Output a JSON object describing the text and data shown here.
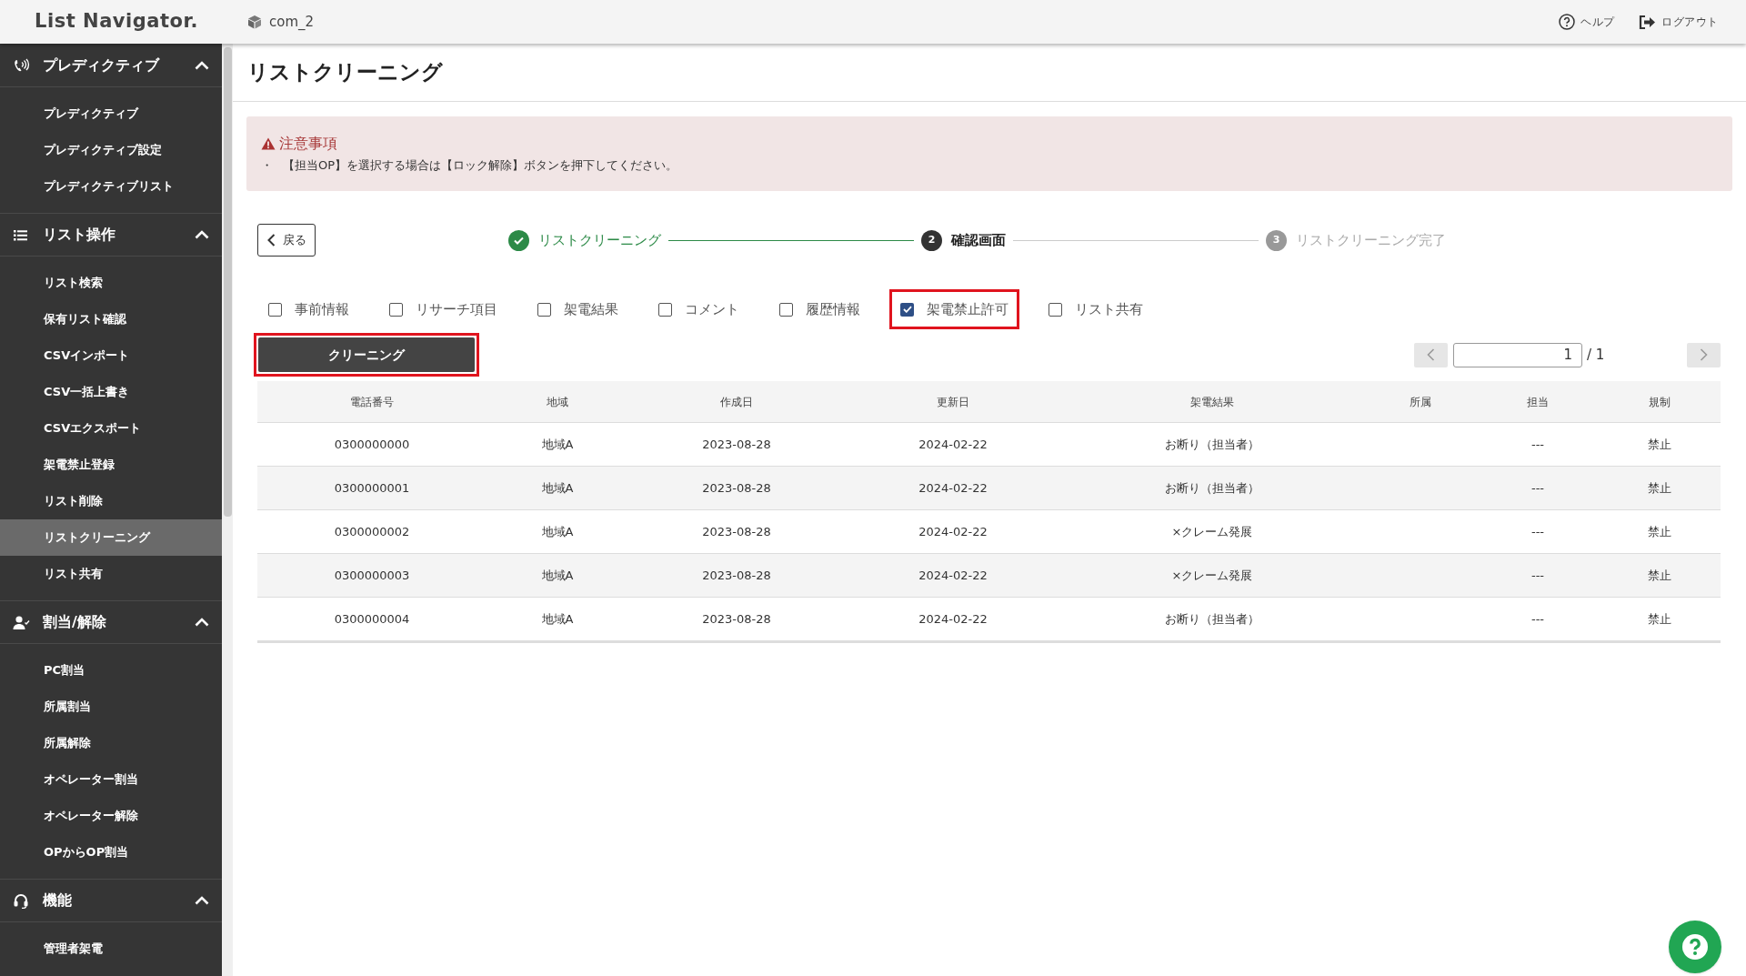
{
  "header": {
    "logo": "List Navigator.",
    "company": "com_2",
    "links": [
      {
        "kind": "help",
        "label": "ヘルプ"
      },
      {
        "kind": "logout",
        "label": "ログアウト"
      }
    ]
  },
  "sidebar": {
    "sections": [
      {
        "kind": "phone",
        "label": "プレディクティブ",
        "expanded": true,
        "items": [
          {
            "label": "プレディクティブ",
            "selected": false
          },
          {
            "label": "プレディクティブ設定",
            "selected": false
          },
          {
            "label": "プレディクティブリスト",
            "selected": false
          }
        ]
      },
      {
        "kind": "list",
        "label": "リスト操作",
        "expanded": true,
        "items": [
          {
            "label": "リスト検索",
            "selected": false
          },
          {
            "label": "保有リスト確認",
            "selected": false
          },
          {
            "label": "CSVインポート",
            "selected": false
          },
          {
            "label": "CSV一括上書き",
            "selected": false
          },
          {
            "label": "CSVエクスポート",
            "selected": false
          },
          {
            "label": "架電禁止登録",
            "selected": false
          },
          {
            "label": "リスト削除",
            "selected": false
          },
          {
            "label": "リストクリーニング",
            "selected": true
          },
          {
            "label": "リスト共有",
            "selected": false
          }
        ]
      },
      {
        "kind": "user",
        "label": "割当/解除",
        "expanded": true,
        "items": [
          {
            "label": "PC割当",
            "selected": false
          },
          {
            "label": "所属割当",
            "selected": false
          },
          {
            "label": "所属解除",
            "selected": false
          },
          {
            "label": "オペレーター割当",
            "selected": false
          },
          {
            "label": "オペレーター解除",
            "selected": false
          },
          {
            "label": "OPからOP割当",
            "selected": false
          }
        ]
      },
      {
        "kind": "headset",
        "label": "機能",
        "expanded": true,
        "items": [
          {
            "label": "管理者架電",
            "selected": false
          }
        ]
      }
    ]
  },
  "page": {
    "title": "リストクリーニング",
    "notice": {
      "title": "注意事項",
      "bullet": "・",
      "text": "【担当OP】を選択する場合は【ロック解除】ボタンを押下してください。"
    },
    "back_button": "戻る",
    "steps": [
      {
        "done": true,
        "current": false,
        "label": "リストクリーニング"
      },
      {
        "done": false,
        "current": true,
        "number": "2",
        "label": "確認画面"
      },
      {
        "done": false,
        "current": false,
        "number": "3",
        "label": "リストクリーニング完了"
      }
    ],
    "options": [
      {
        "label": "事前情報",
        "checked": false,
        "highlighted": false
      },
      {
        "label": "リサーチ項目",
        "checked": false,
        "highlighted": false
      },
      {
        "label": "架電結果",
        "checked": false,
        "highlighted": false
      },
      {
        "label": "コメント",
        "checked": false,
        "highlighted": false
      },
      {
        "label": "履歴情報",
        "checked": false,
        "highlighted": false
      },
      {
        "label": "架電禁止許可",
        "checked": true,
        "highlighted": true
      },
      {
        "label": "リスト共有",
        "checked": false,
        "highlighted": false
      }
    ],
    "clean_button": {
      "label": "クリーニング",
      "highlighted": true
    },
    "pager": {
      "value": "1",
      "total": "/ 1"
    },
    "table": {
      "columns": [
        "電話番号",
        "地域",
        "作成日",
        "更新日",
        "架電結果",
        "所属",
        "担当",
        "規制"
      ],
      "rows": [
        [
          "0300000000",
          "地域A",
          "2023-08-28",
          "2024-02-22",
          "お断り（担当者）",
          "",
          "---",
          "禁止"
        ],
        [
          "0300000001",
          "地域A",
          "2023-08-28",
          "2024-02-22",
          "お断り（担当者）",
          "",
          "---",
          "禁止"
        ],
        [
          "0300000002",
          "地域A",
          "2023-08-28",
          "2024-02-22",
          "×クレーム発展",
          "",
          "---",
          "禁止"
        ],
        [
          "0300000003",
          "地域A",
          "2023-08-28",
          "2024-02-22",
          "×クレーム発展",
          "",
          "---",
          "禁止"
        ],
        [
          "0300000004",
          "地域A",
          "2023-08-28",
          "2024-02-22",
          "お断り（担当者）",
          "",
          "---",
          "禁止"
        ]
      ]
    }
  }
}
